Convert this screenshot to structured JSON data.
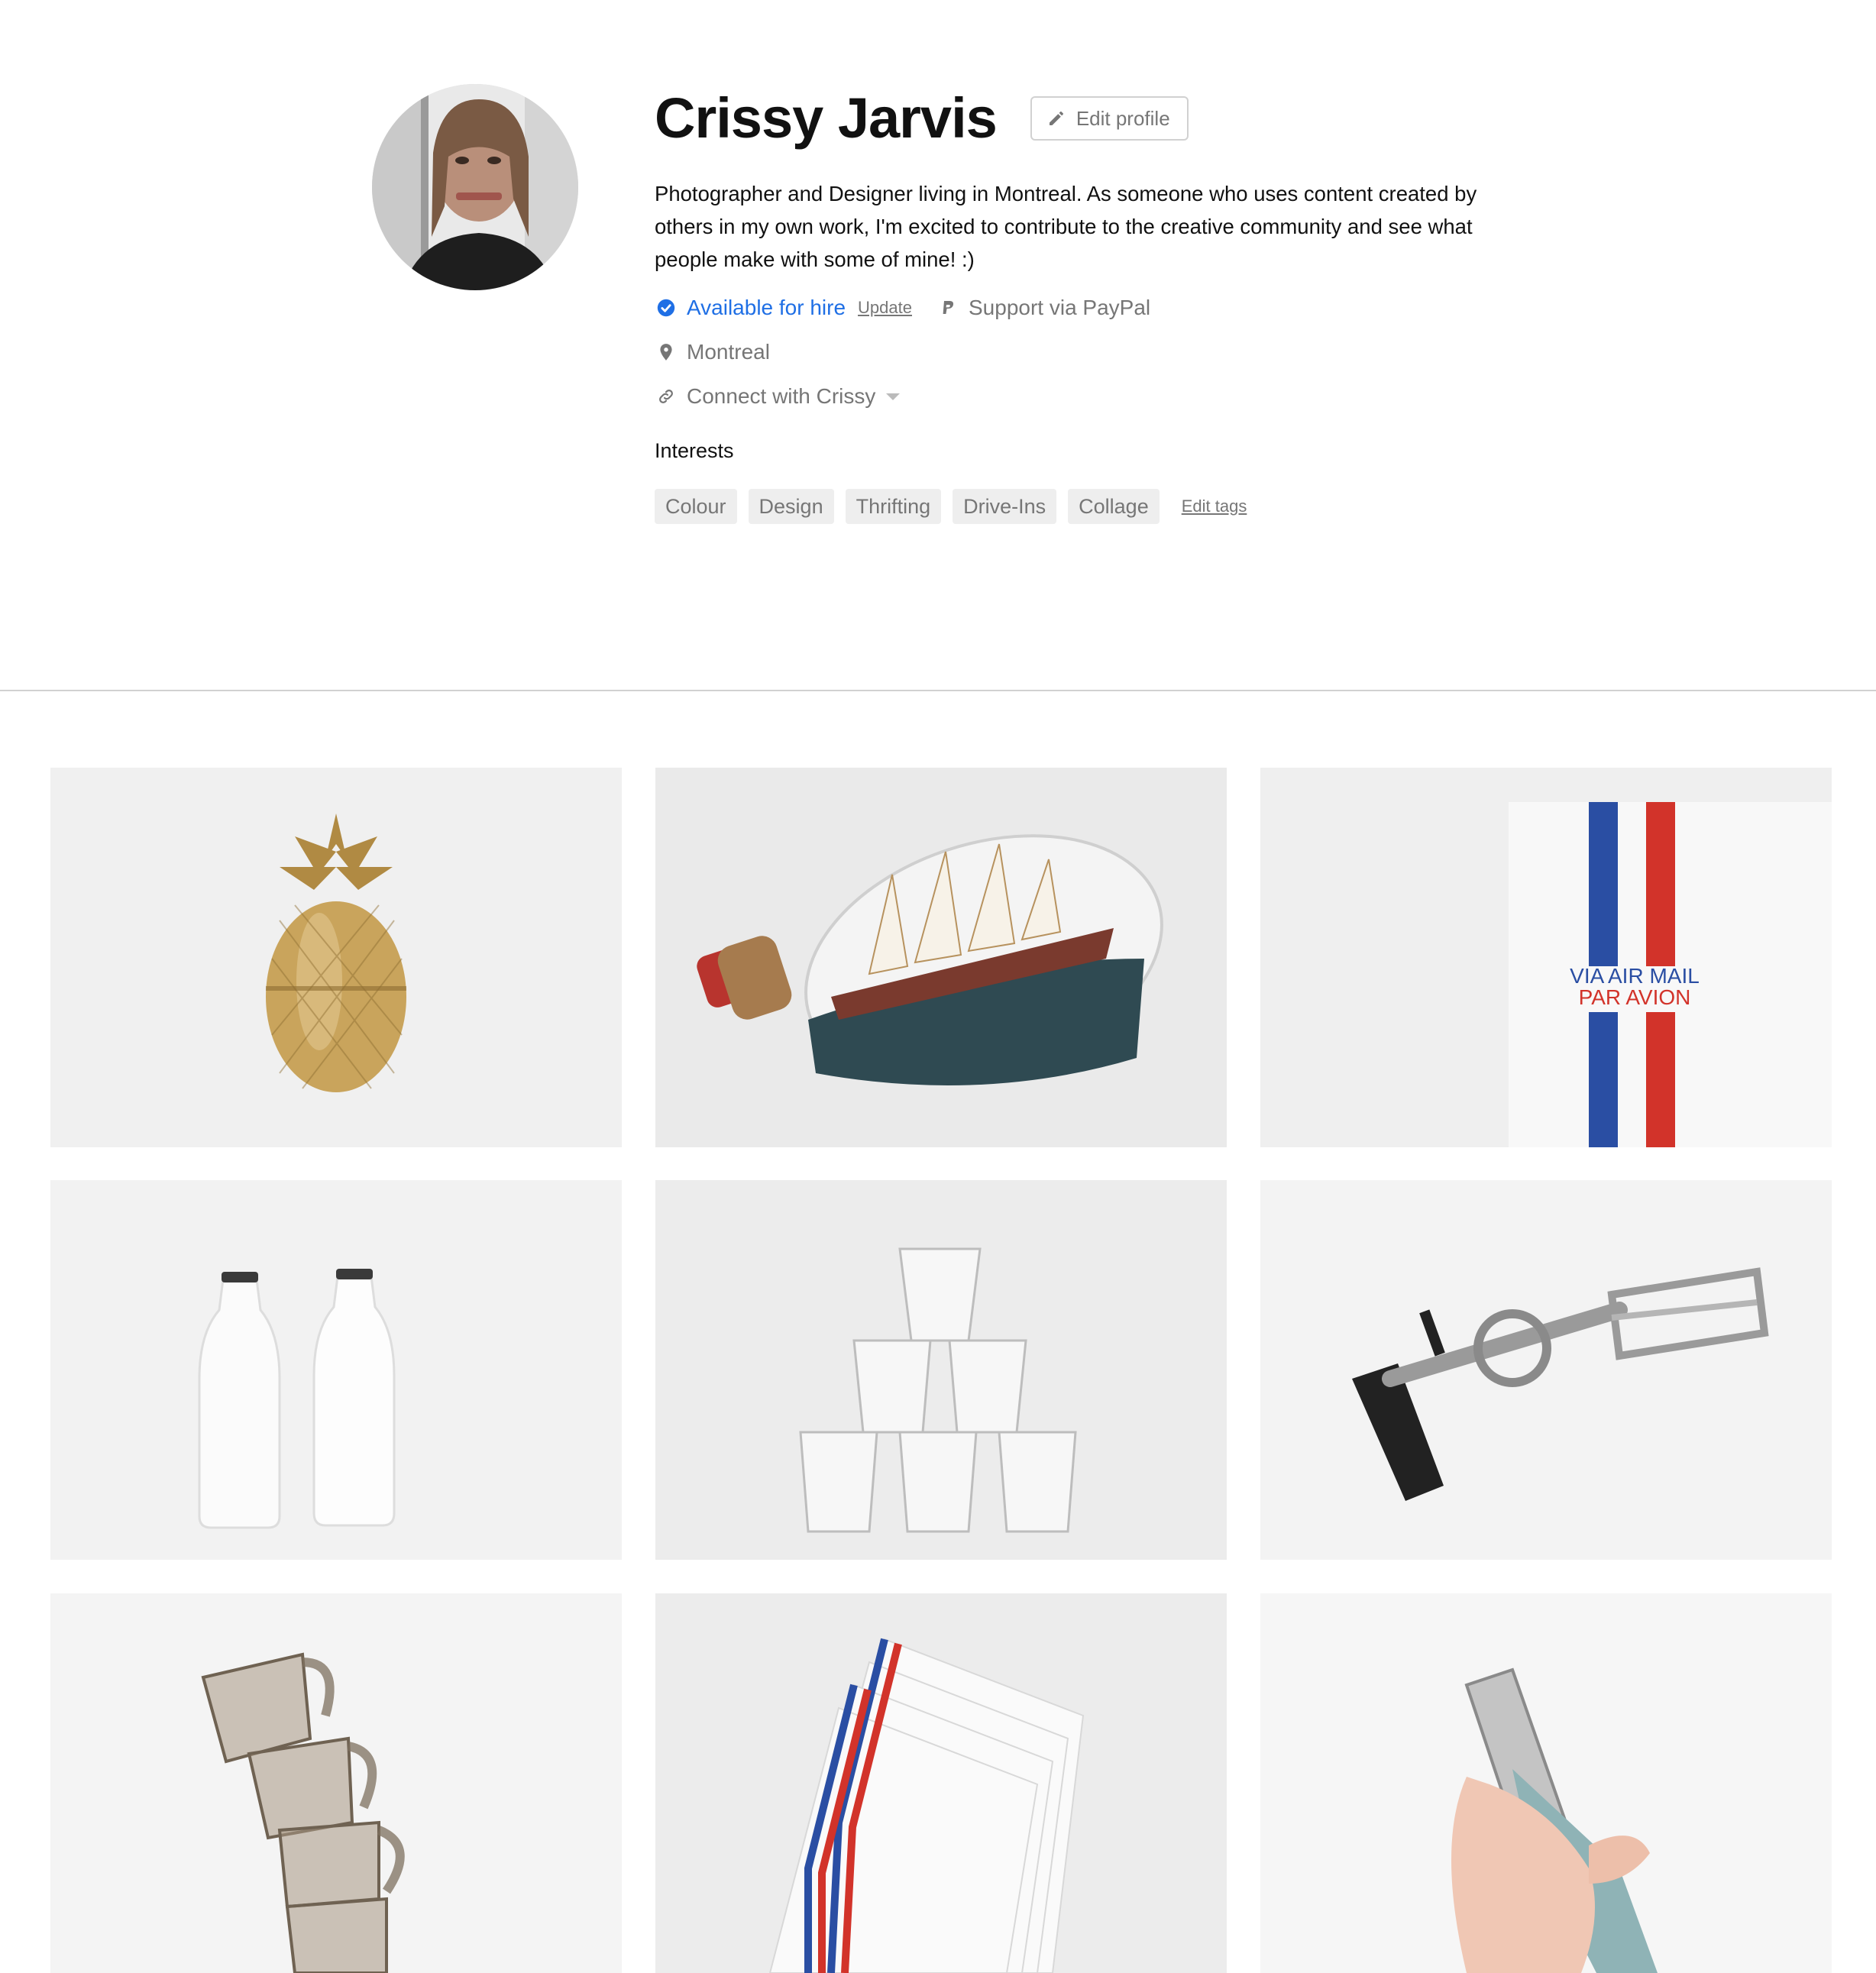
{
  "profile": {
    "name": "Crissy Jarvis",
    "edit_profile_label": "Edit profile",
    "bio": "Photographer and Designer living in Montreal. As someone who uses content created by others in my own work, I'm excited to contribute to the creative community and see what people make with some of mine! :)",
    "hire_status": "Available for hire",
    "update_label": "Update",
    "paypal_label": "Support via PayPal",
    "location": "Montreal",
    "connect_label": "Connect with Crissy",
    "interests_label": "Interests",
    "tags": [
      "Colour",
      "Design",
      "Thrifting",
      "Drive-Ins",
      "Collage"
    ],
    "edit_tags_label": "Edit tags"
  },
  "photos": [
    {
      "subject": "gold pineapple"
    },
    {
      "subject": "ship in a bottle"
    },
    {
      "subject": "air mail envelope",
      "text1": "VIA AIR MAIL",
      "text2": "PAR AVION"
    },
    {
      "subject": "white milk bottles"
    },
    {
      "subject": "stacked glasses"
    },
    {
      "subject": "hand egg beater"
    },
    {
      "subject": "glass mugs"
    },
    {
      "subject": "air mail envelopes"
    },
    {
      "subject": "hole punch"
    }
  ],
  "colors": {
    "accent_blue": "#1f6fe5",
    "muted_text": "#767676",
    "tag_bg": "#eeeeee",
    "airmail_red": "#d2332a",
    "airmail_blue": "#2a4ea3"
  }
}
